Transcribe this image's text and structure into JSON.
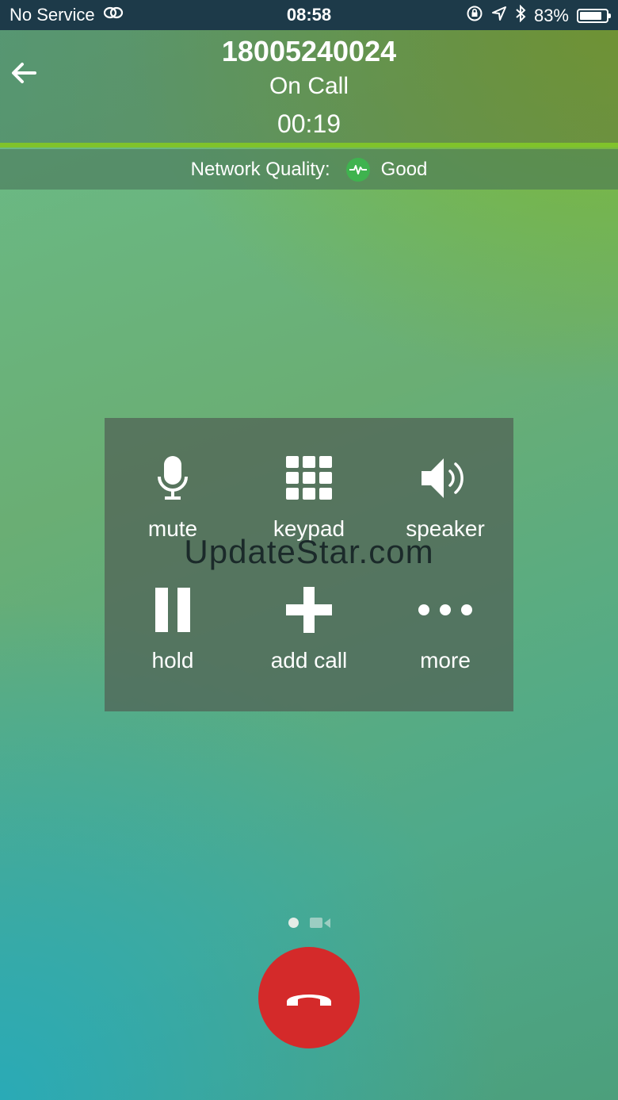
{
  "status_bar": {
    "carrier": "No Service",
    "time": "08:58",
    "battery_percent": "83%",
    "battery_level": 0.83,
    "icons": [
      "link-icon",
      "rotation-lock-icon",
      "location-arrow-icon",
      "bluetooth-icon",
      "battery-icon"
    ]
  },
  "call": {
    "number": "18005240024",
    "status": "On Call",
    "timer": "00:19"
  },
  "network": {
    "label": "Network Quality:",
    "quality": "Good",
    "icon": "pulse-icon",
    "color": "#3fb34f"
  },
  "controls": [
    {
      "label": "mute",
      "icon": "microphone-icon"
    },
    {
      "label": "keypad",
      "icon": "keypad-grid-icon"
    },
    {
      "label": "speaker",
      "icon": "speaker-icon"
    },
    {
      "label": "hold",
      "icon": "pause-icon"
    },
    {
      "label": "add call",
      "icon": "plus-icon"
    },
    {
      "label": "more",
      "icon": "ellipsis-icon"
    }
  ],
  "watermark": "UpdateStar.com",
  "end_call": {
    "icon": "hang-up-icon",
    "color": "#d42a2a"
  },
  "accent_color": "#80c32b"
}
